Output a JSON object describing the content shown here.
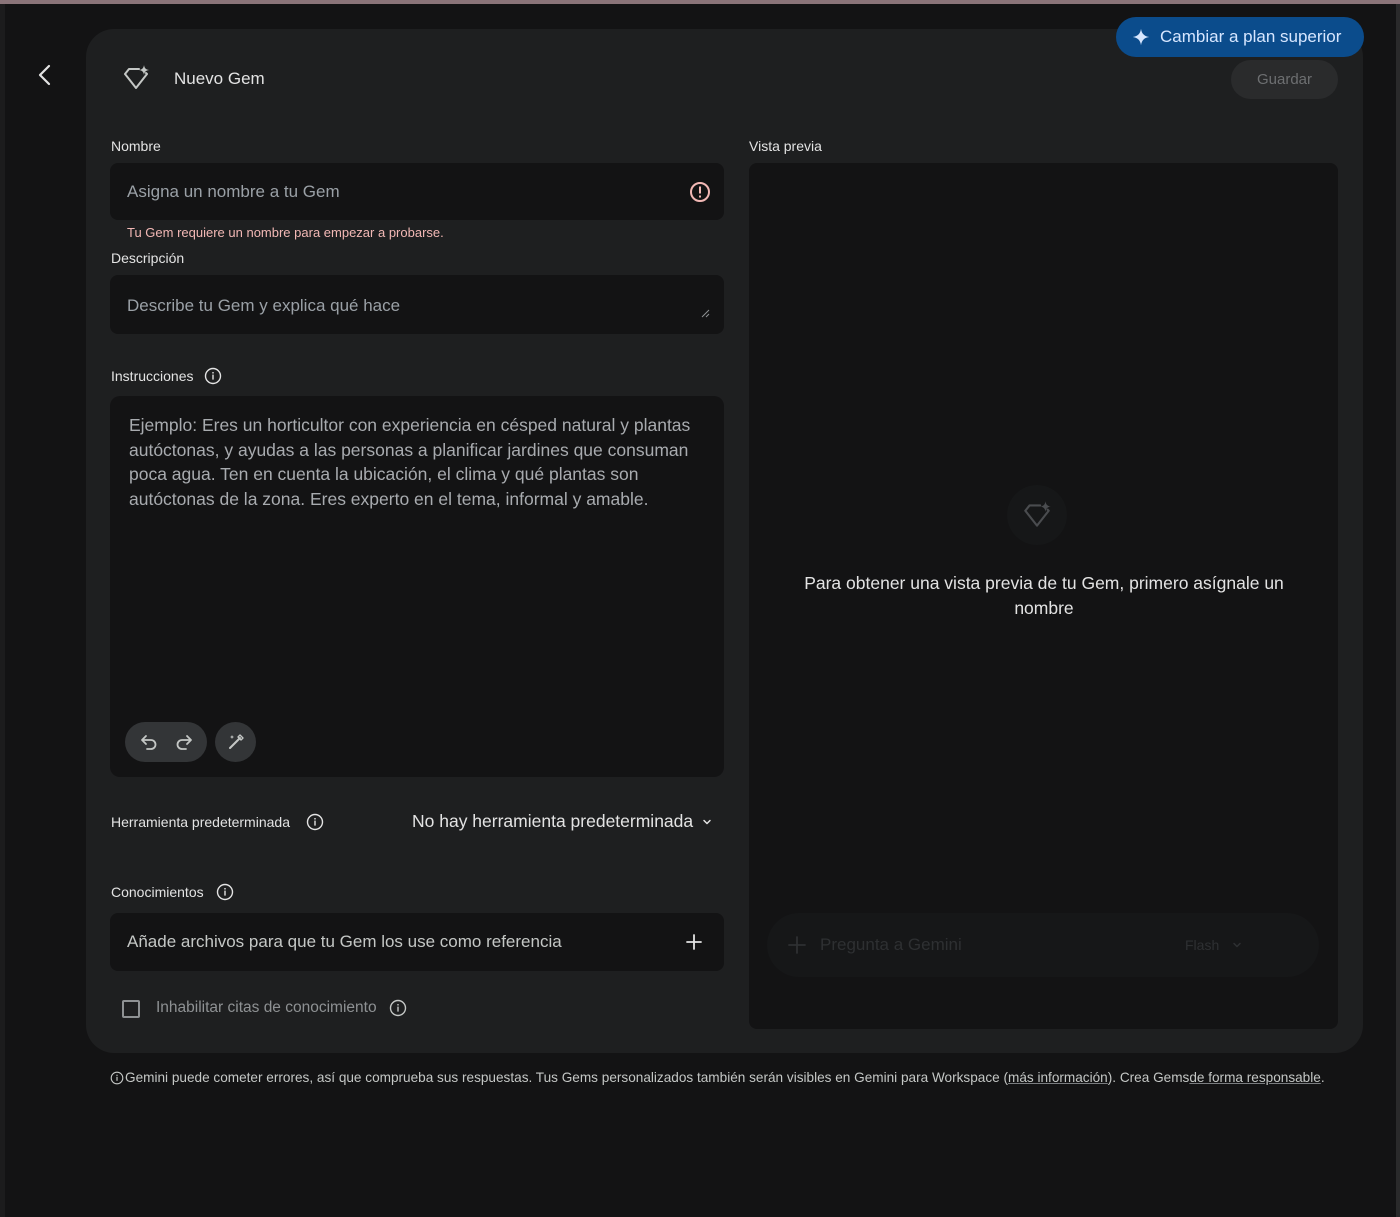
{
  "header": {
    "title": "Nuevo Gem",
    "save_label": "Guardar",
    "upgrade_label": "Cambiar a plan superior"
  },
  "form": {
    "name": {
      "label": "Nombre",
      "placeholder": "Asigna un nombre a tu Gem",
      "value": "",
      "error": "Tu Gem requiere un nombre para empezar a probarse."
    },
    "description": {
      "label": "Descripción",
      "placeholder": "Describe tu Gem y explica qué hace",
      "value": ""
    },
    "instructions": {
      "label": "Instrucciones",
      "placeholder": "Ejemplo: Eres un horticultor con experiencia en césped natural y plantas autóctonas, y ayudas a las personas a planificar jardines que consuman poca agua. Ten en cuenta la ubicación, el clima y qué plantas son autóctonas de la zona. Eres experto en el tema, informal y amable.",
      "value": ""
    },
    "default_tool": {
      "label": "Herramienta predeterminada",
      "selected": "No hay herramienta predeterminada"
    },
    "knowledge": {
      "label": "Conocimientos",
      "placeholder": "Añade archivos para que tu Gem los use como referencia"
    },
    "disable_citations": {
      "label": "Inhabilitar citas de conocimiento",
      "checked": false
    }
  },
  "preview": {
    "label": "Vista previa",
    "message": "Para obtener una vista previa de tu Gem, primero asígnale un nombre",
    "input_placeholder": "Pregunta a Gemini",
    "model": "Flash"
  },
  "footer": {
    "text_1": "Gemini puede cometer errores, así que comprueba sus respuestas. Tus Gems personalizados también serán visibles en Gemini para Workspace (",
    "link_1": "más información",
    "text_2": "). Crea Gems ",
    "link_2": "de forma responsable",
    "text_3": "."
  },
  "colors": {
    "background": "#131314",
    "card": "#1e1f20",
    "accent": "#0b4c8c",
    "error": "#f2b8b5"
  },
  "icons": {
    "back": "chevron-left-icon",
    "gem": "gem-sparkle-icon",
    "sparkle": "sparkle-icon",
    "error": "error-circle-icon",
    "info": "info-icon",
    "undo": "undo-icon",
    "redo": "redo-icon",
    "magic": "magic-wand-icon",
    "add": "plus-icon",
    "dropdown": "chevron-down-icon"
  }
}
